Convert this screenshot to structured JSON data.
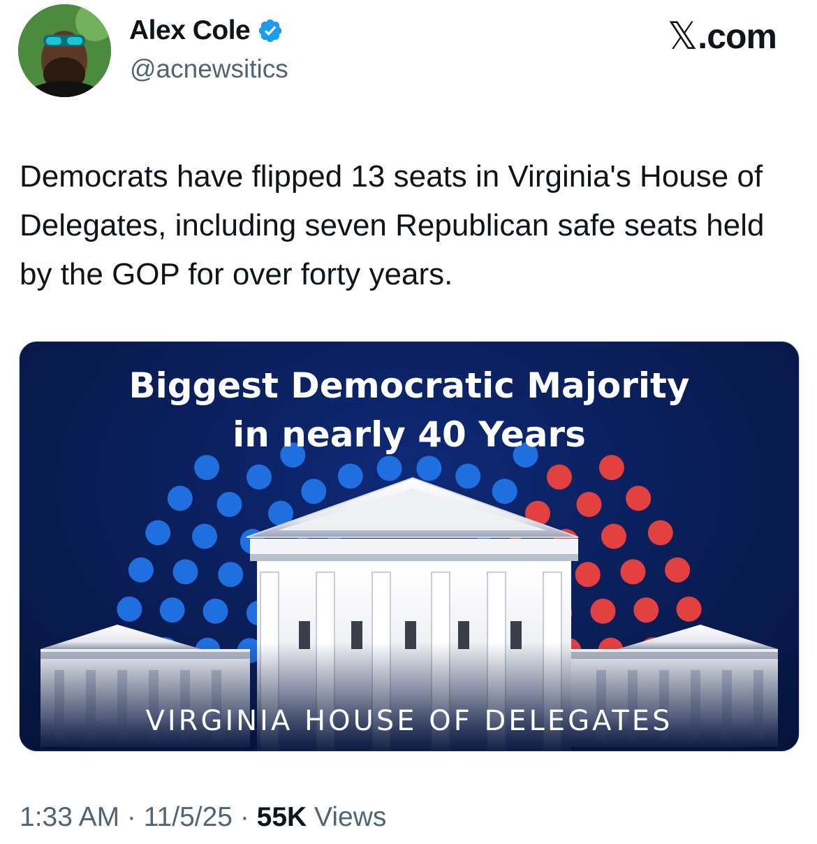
{
  "author": {
    "display_name": "Alex Cole",
    "handle": "@acnewsitics",
    "verified": true
  },
  "brand": {
    "site": ".com",
    "glyph": "𝕏"
  },
  "tweet": {
    "text": "Democrats have flipped 13 seats in Virginia's House of Delegates, including seven Republican safe seats held by the GOP for over forty years."
  },
  "media": {
    "headline_line1": "Biggest Democratic Majority",
    "headline_line2": "in nearly 40 Years",
    "footer": "VIRGINIA HOUSE OF DELEGATES",
    "colors": {
      "background": "#0a1f5c",
      "democrat_dot": "#1f6fe0",
      "republican_dot": "#e3413f"
    }
  },
  "meta": {
    "time": "1:33 AM",
    "sep1": " · ",
    "date": "11/5/25",
    "sep2": " · ",
    "views_count": "55K",
    "views_label": " Views"
  }
}
